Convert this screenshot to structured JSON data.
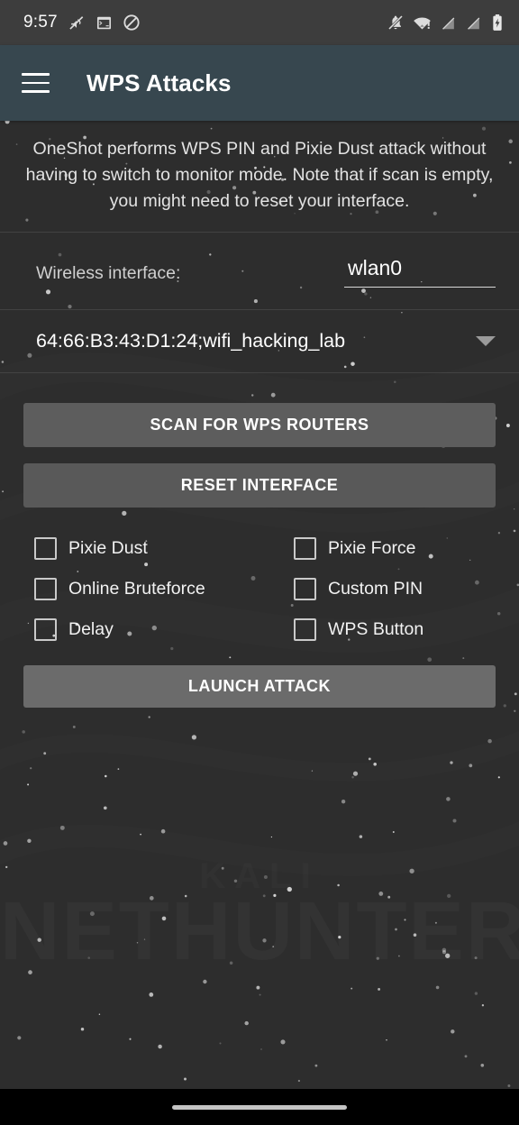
{
  "status_bar": {
    "clock": "9:57",
    "left_icons": [
      {
        "name": "sound-off-icon",
        "label": "silent"
      },
      {
        "name": "terminal-icon",
        "label": "terminal"
      },
      {
        "name": "do-not-disturb-icon",
        "label": "do not disturb"
      }
    ],
    "right_icons": [
      {
        "name": "notifications-off-icon",
        "label": "notifications off"
      },
      {
        "name": "wifi-warning-icon",
        "label": "wifi no internet"
      },
      {
        "name": "no-sim-icon",
        "label": "no sim 1"
      },
      {
        "name": "no-sim-2-icon",
        "label": "no sim 2"
      },
      {
        "name": "battery-charging-icon",
        "label": "charging"
      }
    ]
  },
  "app_bar": {
    "menu_icon": "hamburger-menu-icon",
    "title": "WPS Attacks"
  },
  "description": "OneShot performs WPS PIN and Pixie Dust attack without having to switch to monitor mode. Note that if scan is empty, you might need to reset your interface.",
  "interface": {
    "label": "Wireless interface:",
    "value": "wlan0",
    "placeholder": "wlan0"
  },
  "network_spinner": {
    "selected": "64:66:B3:43:D1:24;wifi_hacking_lab",
    "arrow_icon": "chevron-down-icon"
  },
  "buttons": {
    "scan": "SCAN FOR WPS ROUTERS",
    "reset": "RESET INTERFACE",
    "launch": "LAUNCH ATTACK"
  },
  "options": [
    {
      "label": "Pixie Dust",
      "checked": false
    },
    {
      "label": "Pixie Force",
      "checked": false
    },
    {
      "label": "Online Bruteforce",
      "checked": false
    },
    {
      "label": "Custom PIN",
      "checked": false
    },
    {
      "label": "Delay",
      "checked": false
    },
    {
      "label": "WPS Button",
      "checked": false
    }
  ],
  "wallpaper": {
    "watermark_top": "KALI",
    "watermark_main": "NETHUNTER"
  },
  "nav_bar": {
    "gesture_pill": "home-gesture-pill"
  },
  "colors": {
    "status_bar_bg": "#3d3d3d",
    "app_bar_bg": "#37474f",
    "content_bg": "#2d2d2d",
    "button_bg": "#5d5d5d",
    "launch_button_bg": "#6b6b6b",
    "text_primary": "#ffffff",
    "text_secondary": "#cfcfcf",
    "divider": "#3f3f3f"
  }
}
